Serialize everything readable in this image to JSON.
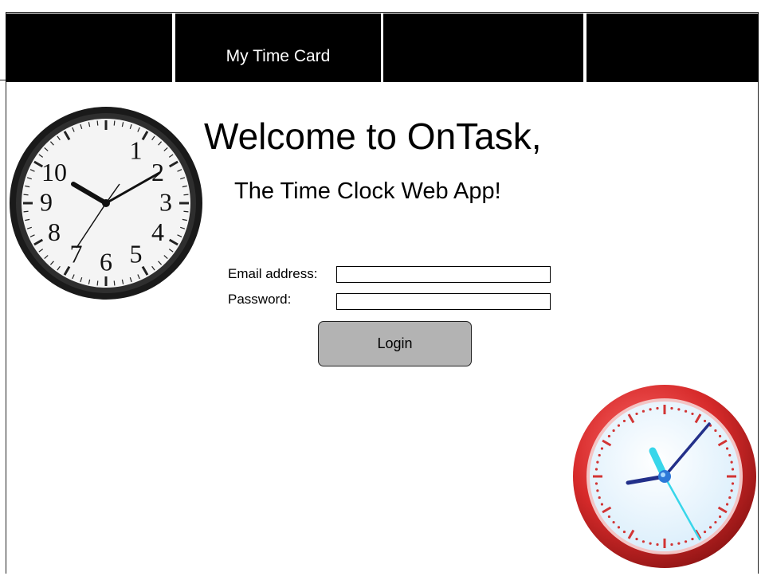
{
  "nav": {
    "tabs": [
      {
        "label": ""
      },
      {
        "label": "My Time Card"
      },
      {
        "label": ""
      },
      {
        "label": ""
      }
    ]
  },
  "welcome": {
    "title": "Welcome to OnTask,",
    "subtitle": "The Time Clock Web App!"
  },
  "login_form": {
    "email_label": "Email address:",
    "email_value": "",
    "password_label": "Password:",
    "password_value": "",
    "login_button": "Login"
  },
  "decor": {
    "left_clock": {
      "icon": "analog-clock-icon",
      "numerals": [
        "1",
        "2",
        "3",
        "4",
        "5",
        "6",
        "7",
        "8",
        "9",
        "10"
      ]
    },
    "right_clock": {
      "icon": "red-analog-clock-icon"
    }
  },
  "colors": {
    "nav_background": "#000000",
    "nav_text": "#ffffff",
    "button_background": "#b3b3b3",
    "right_clock_rim": "#d62a2a"
  }
}
